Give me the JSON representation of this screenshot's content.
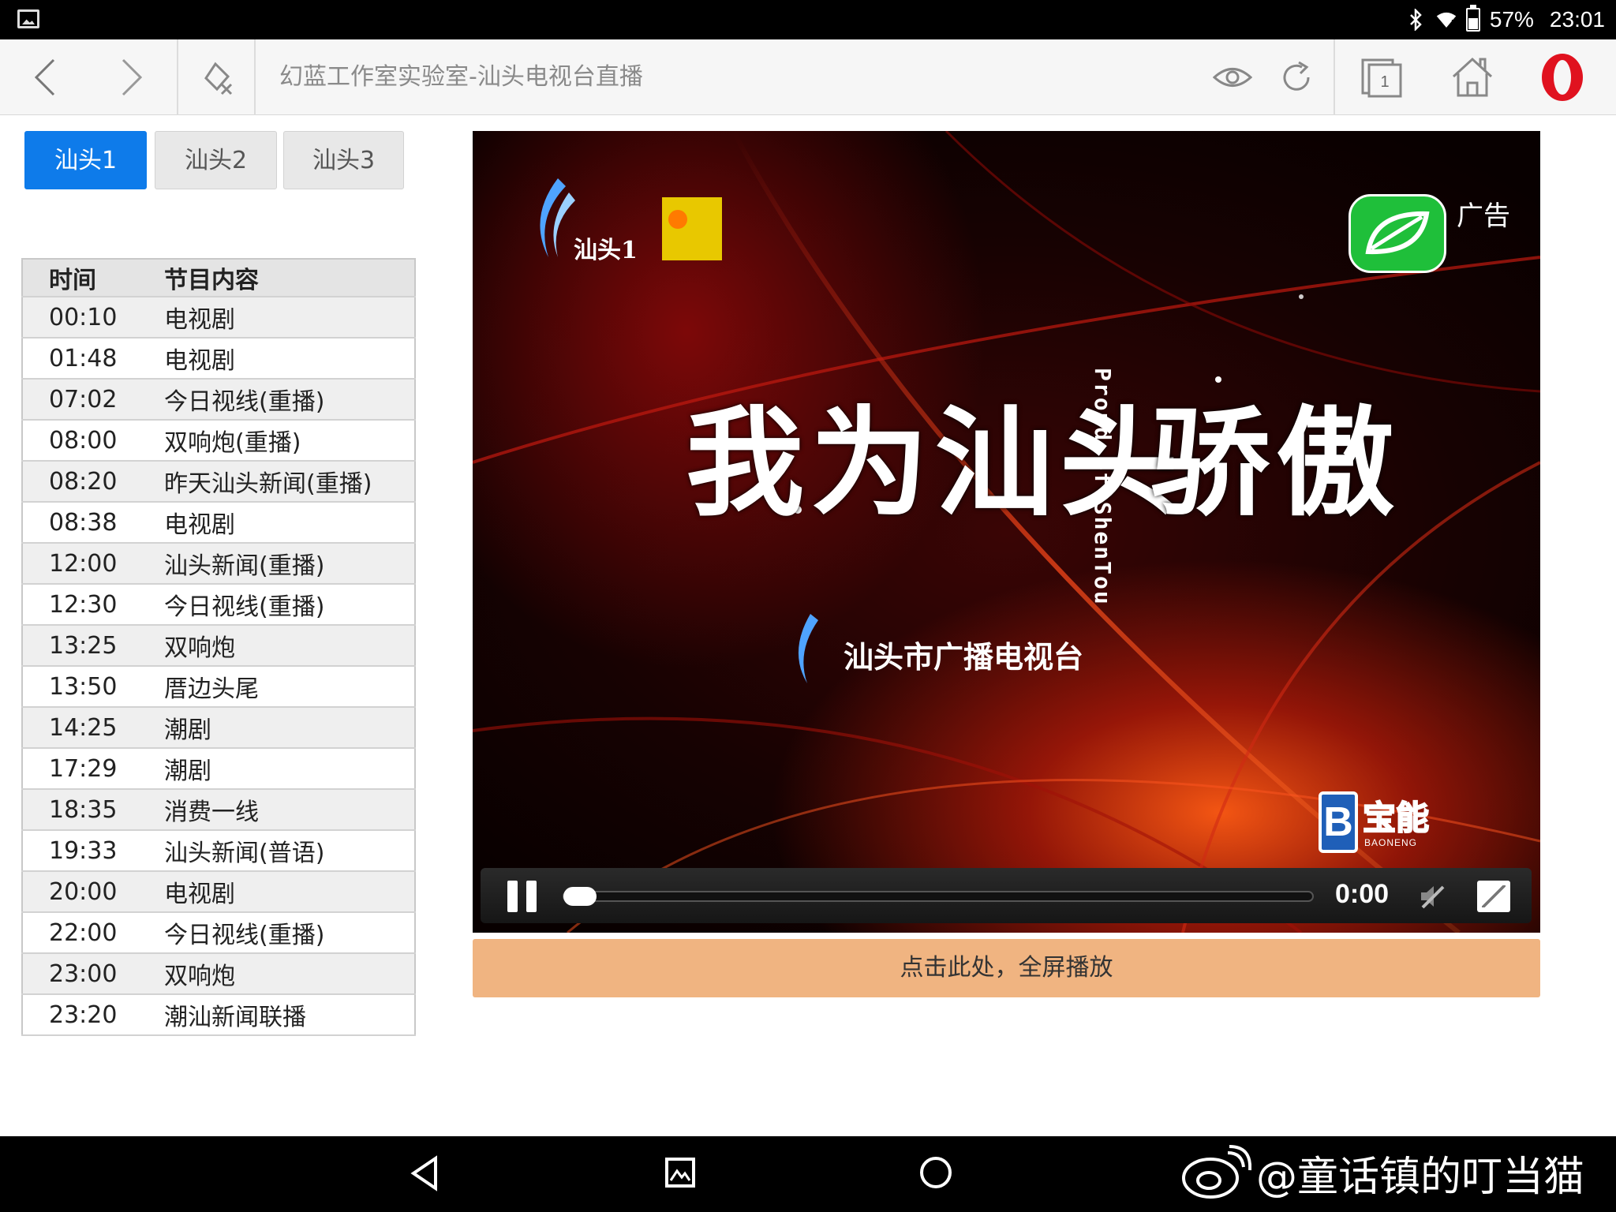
{
  "status_bar": {
    "battery": "57%",
    "time": "23:01"
  },
  "browser": {
    "page_title": "幻蓝工作室实验室-汕头电视台直播",
    "tab_count": "1"
  },
  "channel_tabs": [
    {
      "label": "汕头1",
      "active": true
    },
    {
      "label": "汕头2",
      "active": false
    },
    {
      "label": "汕头3",
      "active": false
    }
  ],
  "schedule": {
    "headers": [
      "时间",
      "节目内容"
    ],
    "rows": [
      [
        "00:10",
        "电视剧"
      ],
      [
        "01:48",
        "电视剧"
      ],
      [
        "07:02",
        "今日视线(重播)"
      ],
      [
        "08:00",
        "双响炮(重播)"
      ],
      [
        "08:20",
        "昨天汕头新闻(重播)"
      ],
      [
        "08:38",
        "电视剧"
      ],
      [
        "12:00",
        "汕头新闻(重播)"
      ],
      [
        "12:30",
        "今日视线(重播)"
      ],
      [
        "13:25",
        "双响炮"
      ],
      [
        "13:50",
        "厝边头尾"
      ],
      [
        "14:25",
        "潮剧"
      ],
      [
        "17:29",
        "潮剧"
      ],
      [
        "18:35",
        "消费一线"
      ],
      [
        "19:33",
        "汕头新闻(普语)"
      ],
      [
        "20:00",
        "电视剧"
      ],
      [
        "22:00",
        "今日视线(重播)"
      ],
      [
        "23:00",
        "双响炮"
      ],
      [
        "23:20",
        "潮汕新闻联播"
      ]
    ]
  },
  "video": {
    "channel_logo_text": "汕头1",
    "ad_label": "广告",
    "hero_text_left": "我为汕头",
    "hero_text_right": "骄傲",
    "hero_english": "Proud of ShenTou",
    "station_name": "汕头市广播电视台",
    "sponsor_logo_text": "宝能",
    "sponsor_logo_sub": "BAONENG",
    "time": "0:00",
    "progress": 0.0
  },
  "fullscreen_label": "点击此处，全屏播放",
  "watermark": "@童话镇的叮当猫",
  "colors": {
    "accent_blue": "#0e7bea",
    "fullscreen_bar": "#f0b481",
    "opera_red": "#e0121f"
  }
}
